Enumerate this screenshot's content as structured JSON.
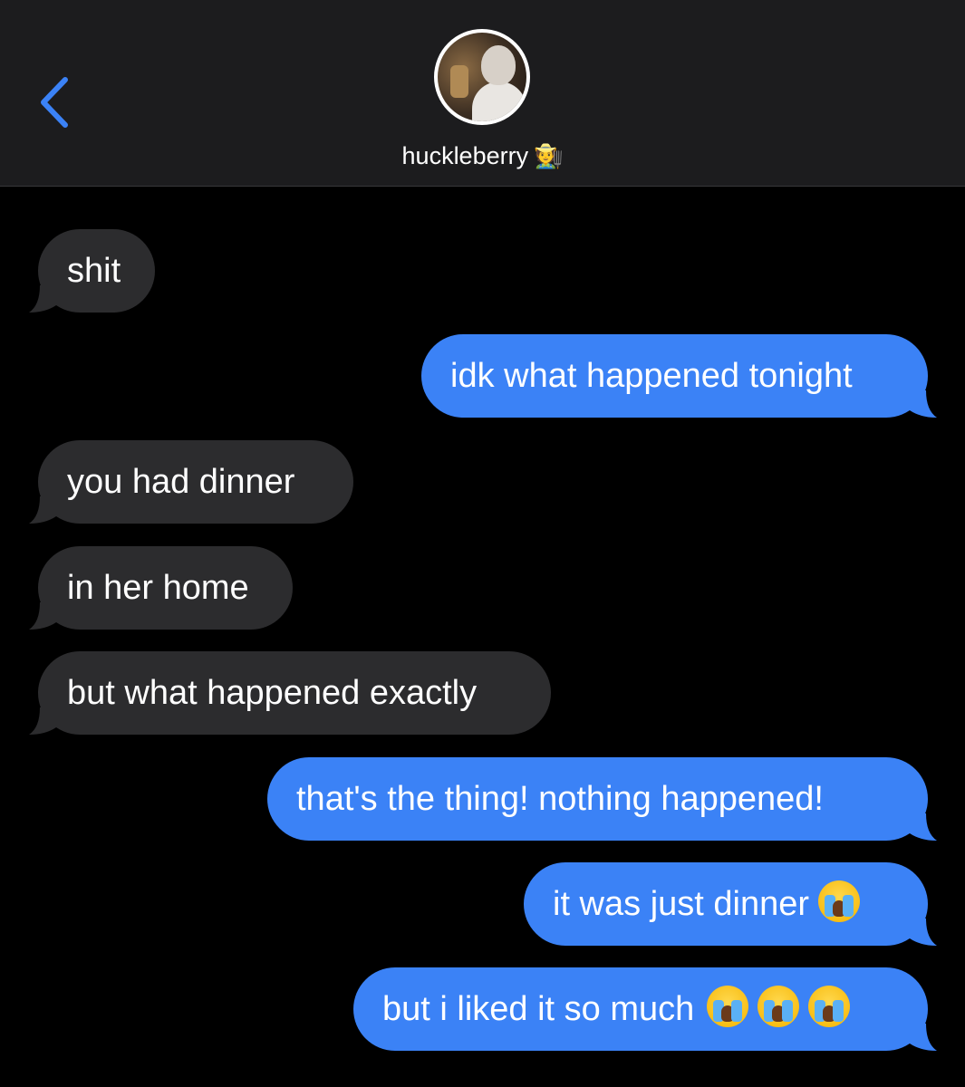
{
  "header": {
    "back_icon": "chevron-left-icon",
    "contact_name": "huckleberry",
    "contact_emoji": "🧑‍🌾",
    "accent_color": "#3b82f6"
  },
  "messages": [
    {
      "direction": "incoming",
      "text": "shit"
    },
    {
      "direction": "outgoing",
      "text": "idk what happened tonight"
    },
    {
      "direction": "incoming",
      "text": "you had dinner"
    },
    {
      "direction": "incoming",
      "text": "in her home"
    },
    {
      "direction": "incoming",
      "text": "but what happened exactly"
    },
    {
      "direction": "outgoing",
      "text": "that's the thing! nothing happened!"
    },
    {
      "direction": "outgoing",
      "text": "it was just dinner",
      "emoji_count": 1
    },
    {
      "direction": "outgoing",
      "text": "but i liked it so much",
      "emoji_count": 3
    }
  ],
  "colors": {
    "incoming_bubble": "#2c2c2e",
    "outgoing_bubble": "#3b82f6",
    "header_bg": "#1c1c1e",
    "background": "#000000"
  }
}
